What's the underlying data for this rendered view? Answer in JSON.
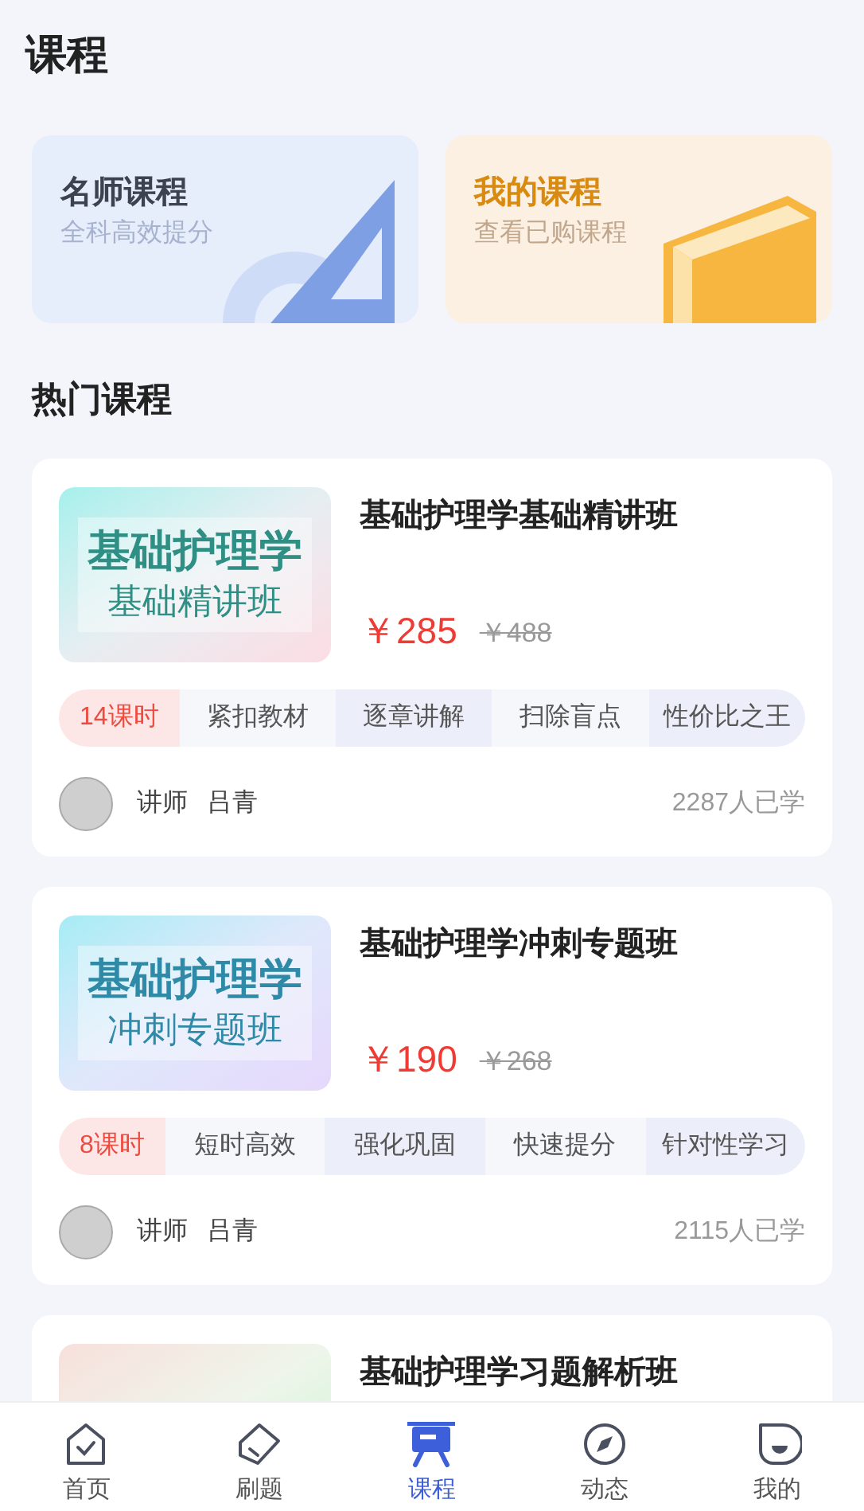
{
  "header": {
    "title": "课程"
  },
  "entry_cards": [
    {
      "kind": "teacher",
      "title": "名师课程",
      "subtitle": "全科高效提分"
    },
    {
      "kind": "mine",
      "title": "我的课程",
      "subtitle": "查看已购课程"
    }
  ],
  "section_title": "热门课程",
  "courses": [
    {
      "thumb": {
        "line_1": "基础护理学",
        "line_2": "基础精讲班"
      },
      "title": "基础护理学基础精讲班",
      "price": "￥285",
      "original_price": "￥488",
      "tags": [
        "14课时",
        "紧扣教材",
        "逐章讲解",
        "扫除盲点",
        "性价比之王"
      ],
      "teacher_label": "讲师",
      "teacher_name": "吕青",
      "learners": "2287人已学"
    },
    {
      "thumb": {
        "line_1": "基础护理学",
        "line_2": "冲刺专题班"
      },
      "title": "基础护理学冲刺专题班",
      "price": "￥190",
      "original_price": "￥268",
      "tags": [
        "8课时",
        "短时高效",
        "强化巩固",
        "快速提分",
        "针对性学习"
      ],
      "teacher_label": "讲师",
      "teacher_name": "吕青",
      "learners": "2115人已学"
    },
    {
      "title": "基础护理学习题解析班"
    }
  ],
  "tab_bar": [
    {
      "kind": "home",
      "label": "首页",
      "selected": false
    },
    {
      "kind": "practice",
      "label": "刷题",
      "selected": false
    },
    {
      "kind": "course",
      "label": "课程",
      "selected": true
    },
    {
      "kind": "compass",
      "label": "动态",
      "selected": false
    },
    {
      "kind": "profile",
      "label": "我的",
      "selected": false
    }
  ]
}
